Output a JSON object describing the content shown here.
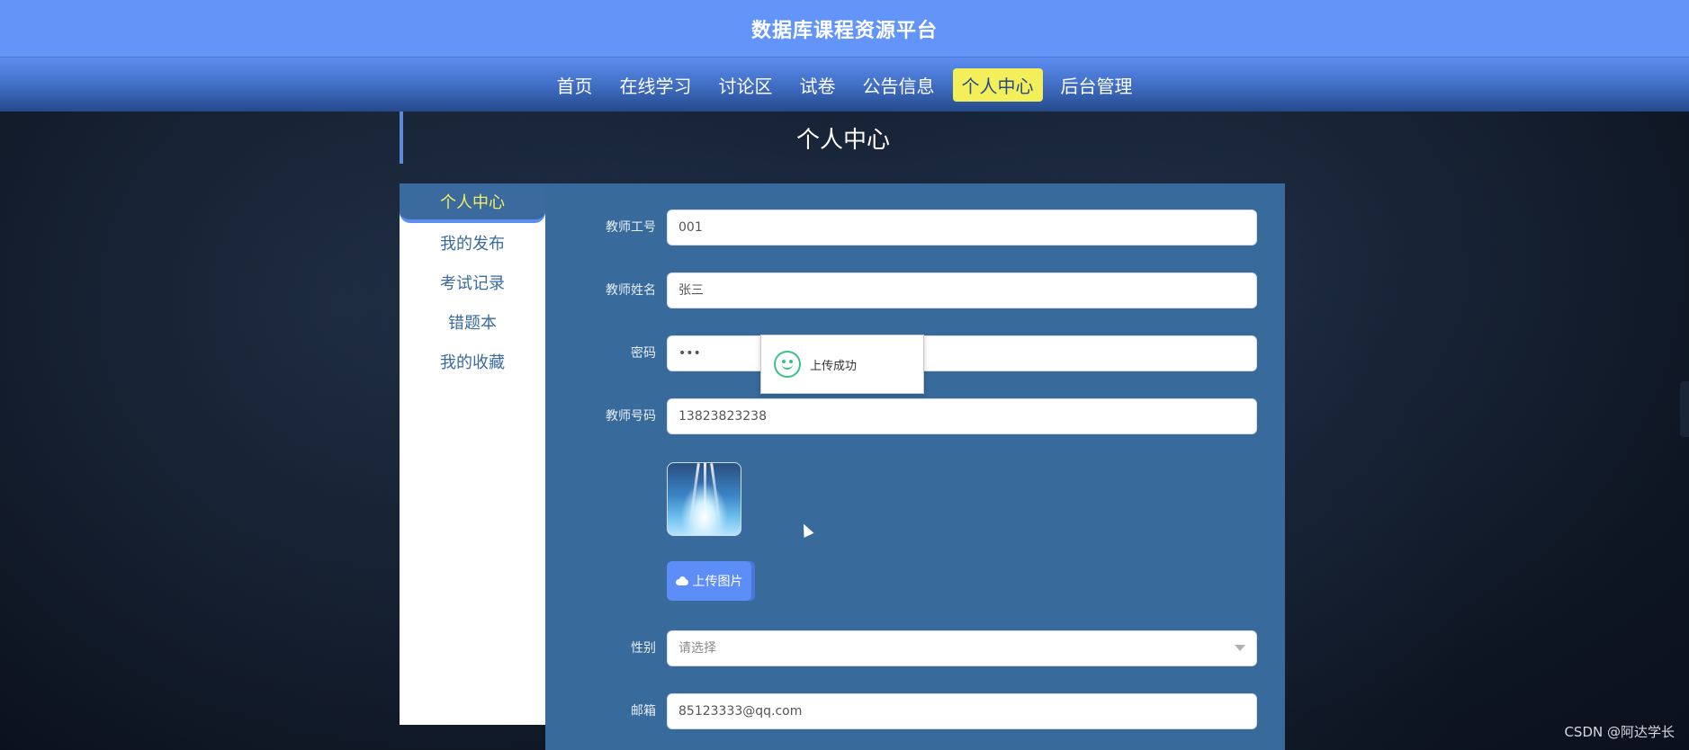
{
  "header": {
    "title": "数据库课程资源平台"
  },
  "nav": {
    "items": [
      {
        "label": "首页"
      },
      {
        "label": "在线学习"
      },
      {
        "label": "讨论区"
      },
      {
        "label": "试卷"
      },
      {
        "label": "公告信息"
      },
      {
        "label": "个人中心"
      },
      {
        "label": "后台管理"
      }
    ],
    "active_index": 5
  },
  "section": {
    "title": "个人中心"
  },
  "sidebar": {
    "header": "个人中心",
    "items": [
      {
        "label": "我的发布"
      },
      {
        "label": "考试记录"
      },
      {
        "label": "错题本"
      },
      {
        "label": "我的收藏"
      }
    ]
  },
  "form": {
    "teacher_id": {
      "label": "教师工号",
      "value": "001"
    },
    "teacher_name": {
      "label": "教师姓名",
      "value": "张三"
    },
    "password": {
      "label": "密码",
      "value": "•••"
    },
    "phone": {
      "label": "教师号码",
      "value": "13823823238"
    },
    "upload_button": "上传图片",
    "gender": {
      "label": "性别",
      "placeholder": "请选择"
    },
    "email": {
      "label": "邮箱",
      "value": "85123333@qq.com"
    }
  },
  "toast": {
    "message": "上传成功"
  },
  "watermark": "CSDN @阿达学长",
  "colors": {
    "topbar": "#6395f9",
    "nav_active": "#f3ef5a",
    "panel": "#386a9c",
    "sidebar_head_text": "#f4ee63"
  }
}
